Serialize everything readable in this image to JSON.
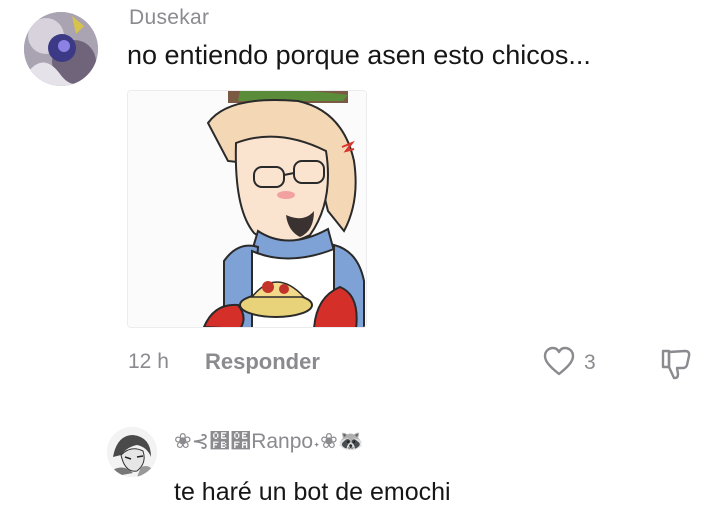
{
  "comment": {
    "username": "Dusekar",
    "text": "no entiendo porque asen esto chicos...",
    "avatar_icon": "anime-avatar-icon",
    "attachment_icon": "anime-character-image"
  },
  "meta": {
    "time": "12 h",
    "reply_label": "Responder",
    "like_count": "3",
    "like_icon": "heart-outline-icon",
    "dislike_icon": "thumbs-down-outline-icon"
  },
  "reply": {
    "username": "❀⊰໻໺Ranpo⁣˖❀🦝",
    "text": "te haré un bot de emochi",
    "avatar_icon": "manga-avatar-icon"
  },
  "colors": {
    "text": "#161616",
    "muted": "#8a8a8f",
    "background": "#ffffff"
  }
}
